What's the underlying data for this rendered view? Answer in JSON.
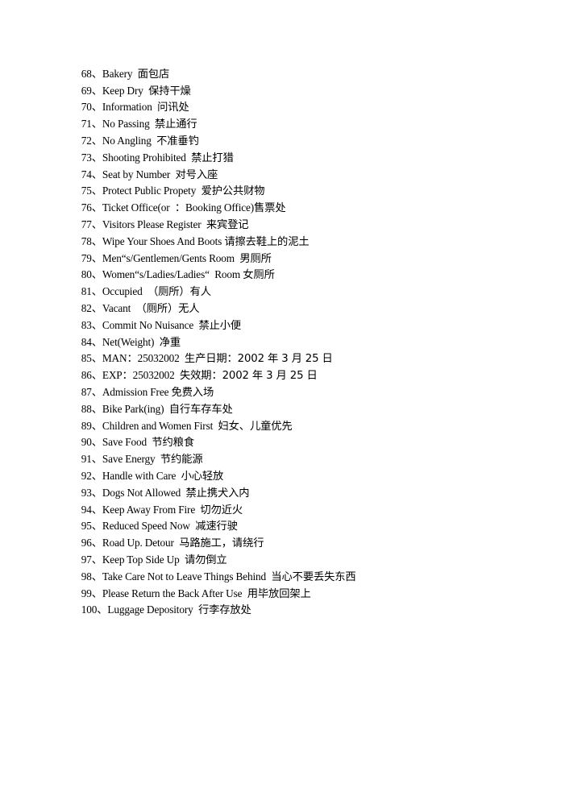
{
  "document": {
    "items": [
      {
        "num": "68、",
        "en": "Bakery  ",
        "zh": "面包店"
      },
      {
        "num": "69、",
        "en": "Keep Dry  ",
        "zh": "保持干燥"
      },
      {
        "num": "70、",
        "en": "Information  ",
        "zh": "问讯处"
      },
      {
        "num": "71、",
        "en": "No Passing  ",
        "zh": "禁止通行"
      },
      {
        "num": "72、",
        "en": "No Angling  ",
        "zh": "不准垂钓"
      },
      {
        "num": "73、",
        "en": "Shooting Prohibited  ",
        "zh": "禁止打猎"
      },
      {
        "num": "74、",
        "en": "Seat by Number  ",
        "zh": "对号入座"
      },
      {
        "num": "75、",
        "en": "Protect Public Propety  ",
        "zh": "爱护公共财物"
      },
      {
        "num": "76、",
        "en": "Ticket Office(or  ：Booking Office)",
        "zh": "售票处"
      },
      {
        "num": "77、",
        "en": "Visitors Please Register  ",
        "zh": "来宾登记"
      },
      {
        "num": "78、",
        "en": "Wipe Your Shoes And Boots ",
        "zh": "请擦去鞋上的泥土"
      },
      {
        "num": "79、",
        "en": "Men“s/Gentlemen/Gents Room  ",
        "zh": "男厕所"
      },
      {
        "num": "80、",
        "en": "Women“s/Ladies/Ladies“  Room ",
        "zh": "女厕所"
      },
      {
        "num": "81、",
        "en": "Occupied  ",
        "zh": "（厕所）有人"
      },
      {
        "num": "82、",
        "en": "Vacant  ",
        "zh": "（厕所）无人"
      },
      {
        "num": "83、",
        "en": "Commit No Nuisance  ",
        "zh": "禁止小便"
      },
      {
        "num": "84、",
        "en": "Net(Weight)  ",
        "zh": "净重"
      },
      {
        "num": "85、",
        "en": "MAN：25032002  ",
        "zh": "生产日期：2002 年 3 月 25 日"
      },
      {
        "num": "86、",
        "en": "EXP：25032002  ",
        "zh": "失效期：2002 年 3 月 25 日"
      },
      {
        "num": "87、",
        "en": "Admission Free ",
        "zh": "免费入场"
      },
      {
        "num": "88、",
        "en": "Bike Park(ing)  ",
        "zh": "自行车存车处"
      },
      {
        "num": "89、",
        "en": "Children and Women First  ",
        "zh": "妇女、儿童优先"
      },
      {
        "num": "90、",
        "en": "Save Food  ",
        "zh": "节约粮食"
      },
      {
        "num": "91、",
        "en": "Save Energy  ",
        "zh": "节约能源"
      },
      {
        "num": "92、",
        "en": "Handle with Care  ",
        "zh": "小心轻放"
      },
      {
        "num": "93、",
        "en": "Dogs Not Allowed  ",
        "zh": "禁止携犬入内"
      },
      {
        "num": "94、",
        "en": "Keep Away From Fire  ",
        "zh": "切勿近火"
      },
      {
        "num": "95、",
        "en": "Reduced Speed Now  ",
        "zh": "减速行驶"
      },
      {
        "num": "96、",
        "en": "Road Up. Detour  ",
        "zh": "马路施工，请绕行"
      },
      {
        "num": "97、",
        "en": "Keep Top Side Up  ",
        "zh": "请勿倒立"
      },
      {
        "num": "98、",
        "en": "Take Care Not to Leave Things Behind  ",
        "zh": "当心不要丢失东西"
      },
      {
        "num": "99、",
        "en": "Please Return the Back After Use  ",
        "zh": "用毕放回架上"
      },
      {
        "num": "100、",
        "en": "Luggage Depository  ",
        "zh": "行李存放处"
      }
    ]
  }
}
